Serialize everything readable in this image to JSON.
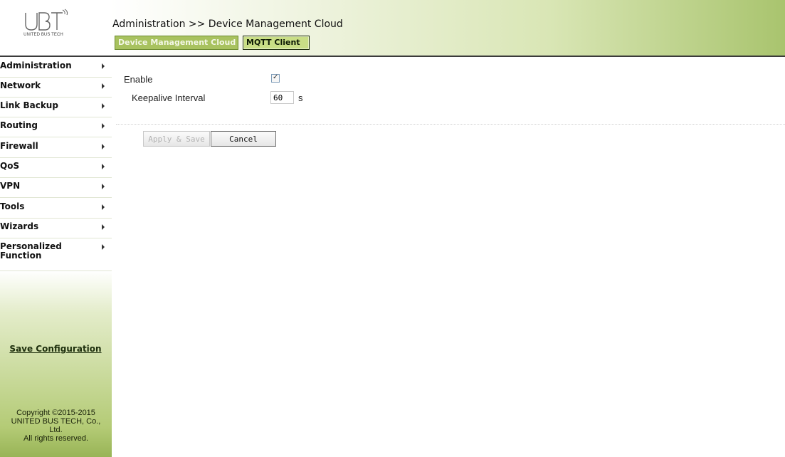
{
  "header": {
    "logo_text": "UBT",
    "logo_subtitle": "UNITED BUS TECH",
    "breadcrumb": "Administration >> Device Management Cloud",
    "tabs": [
      {
        "label": "Device Management Cloud",
        "active": false
      },
      {
        "label": "MQTT Client",
        "active": true
      }
    ]
  },
  "sidebar": {
    "items": [
      {
        "label": "Administration"
      },
      {
        "label": "Network"
      },
      {
        "label": "Link Backup"
      },
      {
        "label": "Routing"
      },
      {
        "label": "Firewall"
      },
      {
        "label": "QoS"
      },
      {
        "label": "VPN"
      },
      {
        "label": "Tools"
      },
      {
        "label": "Wizards"
      },
      {
        "label": "Personalized Function"
      }
    ],
    "save_configuration": "Save Configuration",
    "copyright_lines": [
      "Copyright ©2015-2015",
      "UNITED BUS TECH, Co.,",
      "Ltd.",
      "All rights reserved."
    ]
  },
  "form": {
    "enable_label": "Enable",
    "enable_checked": true,
    "keepalive_label": "Keepalive Interval",
    "keepalive_value": "60",
    "keepalive_unit": "s"
  },
  "buttons": {
    "apply_save": "Apply & Save",
    "apply_save_disabled": true,
    "cancel": "Cancel"
  },
  "colors": {
    "accent_green": "#a8c25f",
    "active_tab": "#c9de86",
    "sidebar_bottom": "#98b456"
  }
}
